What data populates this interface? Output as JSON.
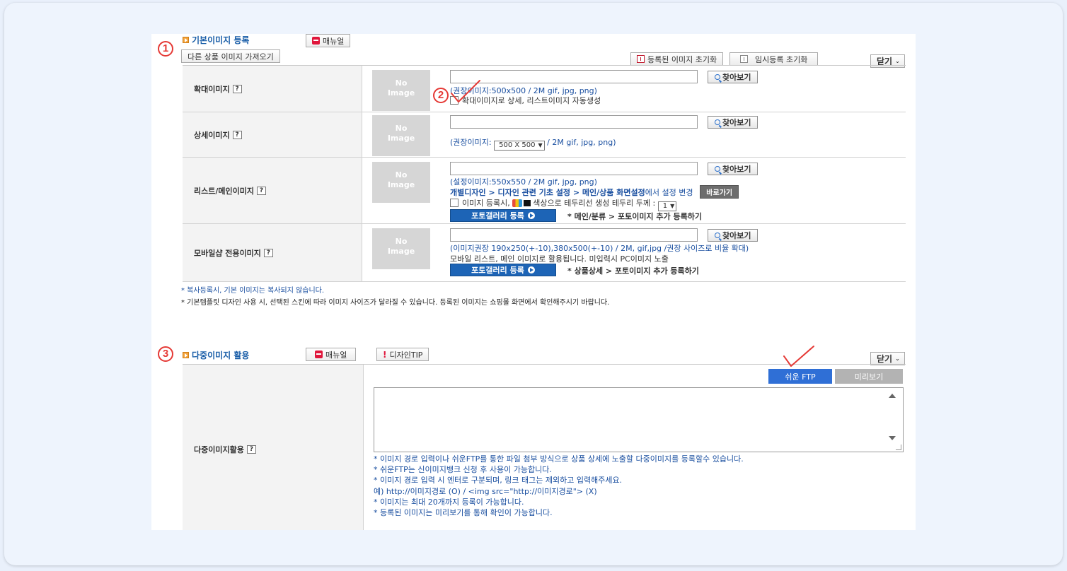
{
  "section1": {
    "number": "1",
    "title": "기본이미지 등록",
    "manual_label": "매뉴얼",
    "copy_btn": "다른 상품 이미지 가져오기",
    "reset_registered": "등록된 이미지 초기화",
    "reset_temp": "임시등록 초기화",
    "close_label": "닫기",
    "rows": [
      {
        "label": "확대이미지",
        "no_image": [
          "No",
          "Image"
        ],
        "find_label": "찾아보기",
        "hint": "(권장이미지:500x500 / 2M gif, jpg, png)",
        "auto_gen": "확대이미지로 상세, 리스트이미지 자동생성"
      },
      {
        "label": "상세이미지",
        "no_image": [
          "No",
          "Image"
        ],
        "find_label": "찾아보기",
        "hint_prefix": "(권장이미지:",
        "size_select": "500 X 500",
        "hint_suffix": "/ 2M gif, jpg, png)"
      },
      {
        "label": "리스트/메인이미지",
        "no_image": [
          "No",
          "Image"
        ],
        "find_label": "찾아보기",
        "hint": "(설정이미지:550x550 / 2M gif, jpg, png)",
        "path_text": "개별디자인 > 디자인 관련 기초 설정 > 메인/상품 화면설정",
        "path_suffix": "에서 설정 변경",
        "goto_label": "바로가기",
        "border_prefix": "이미지 등록시,",
        "border_suffix": "색상으로 테두리선 생성 테두리 두께 :",
        "border_select": "1",
        "gallery_btn": "포토갤러리 등록",
        "gallery_path": "* 메인/분류 > 포토이미지 추가 등록하기"
      },
      {
        "label": "모바일샵 전용이미지",
        "no_image": [
          "No",
          "Image"
        ],
        "find_label": "찾아보기",
        "hint": "(이미지권장 190x250(+-10),380x500(+-10) / 2M, gif,jpg /권장 사이즈로 비율 확대)",
        "desc": "모바일 리스트, 메인 이미지로 활용됩니다. 미입력시 PC이미지 노출",
        "gallery_btn": "포토갤러리 등록",
        "gallery_path": "* 상품상세 > 포토이미지 추가 등록하기"
      }
    ],
    "note1": "* 복사등록시, 기본 이미지는 복사되지 않습니다.",
    "note2": "* 기본템플릿 디자인 사용 시, 선택된 스킨에 따라 이미지 사이즈가 달라질 수 있습니다. 등록된 이미지는 쇼핑몰 화면에서 확인해주시기 바랍니다."
  },
  "step2_number": "2",
  "section3": {
    "number": "3",
    "title": "다중이미지 활용",
    "manual_label": "매뉴얼",
    "design_tip_label": "디자인TIP",
    "close_label": "닫기",
    "row_label": "다중이미지활용",
    "ftp_label": "쉬운 FTP",
    "preview_label": "미리보기",
    "help_lines": [
      "* 이미지 경로 입력이나 쉬운FTP를 통한 파일 첨부 방식으로 상품 상세에 노출할 다중이미지를 등록할수 있습니다.",
      "* 쉬운FTP는 신이미지뱅크 신청 후 사용이 가능합니다.",
      "* 이미지 경로 입력 시 엔터로 구분되며, 링크 태그는 제외하고 입력해주세요.",
      "예) http://이미지경로 (O) / <img src=\"http://이미지경로\"> (X)",
      "* 이미지는 최대 20개까지 등록이 가능합니다.",
      "* 등록된 이미지는 미리보기를 통해 확인이 가능합니다."
    ]
  },
  "colors": {
    "accent_blue": "#1d64b6",
    "ftp_blue": "#2f6fd6",
    "annotation_red": "#e53935",
    "link_blue": "#1a4fa0"
  },
  "icons": [
    "arrow-icon",
    "manual-icon",
    "reset-icon",
    "search-icon",
    "help-icon",
    "play-icon",
    "checkmark-annotation",
    "scroll-up-icon",
    "scroll-down-icon"
  ]
}
